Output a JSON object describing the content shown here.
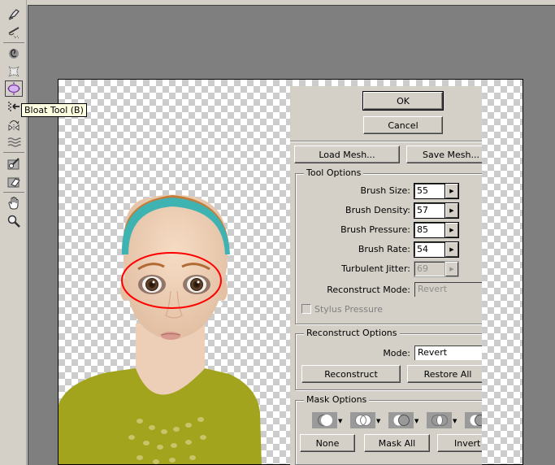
{
  "toolbar": {
    "tools": [
      {
        "name": "forward-warp-tool",
        "icon": "finger-push-icon"
      },
      {
        "name": "reconstruct-tool",
        "icon": "brush-reconstruct-icon"
      },
      {
        "name": "twirl-clockwise-tool",
        "icon": "twirl-icon"
      },
      {
        "name": "pucker-tool",
        "icon": "pucker-icon"
      },
      {
        "name": "bloat-tool",
        "icon": "bloat-icon",
        "active": true
      },
      {
        "name": "push-left-tool",
        "icon": "push-left-icon"
      },
      {
        "name": "mirror-tool",
        "icon": "mirror-icon"
      },
      {
        "name": "turbulence-tool",
        "icon": "turbulence-icon"
      },
      {
        "name": "freeze-mask-tool",
        "icon": "freeze-mask-icon"
      },
      {
        "name": "thaw-mask-tool",
        "icon": "thaw-mask-icon"
      },
      {
        "name": "hand-tool",
        "icon": "hand-icon"
      },
      {
        "name": "zoom-tool",
        "icon": "magnifier-icon"
      }
    ],
    "tooltip": "Bloat Tool (B)"
  },
  "dialog": {
    "ok_label": "OK",
    "cancel_label": "Cancel",
    "load_mesh_label": "Load Mesh...",
    "save_mesh_label": "Save Mesh...",
    "tool_options": {
      "title": "Tool Options",
      "brush_size_label": "Brush Size:",
      "brush_size": "55",
      "brush_density_label": "Brush Density:",
      "brush_density": "57",
      "brush_pressure_label": "Brush Pressure:",
      "brush_pressure": "85",
      "brush_rate_label": "Brush Rate:",
      "brush_rate": "54",
      "turbulent_jitter_label": "Turbulent Jitter:",
      "turbulent_jitter": "69",
      "reconstruct_mode_label": "Reconstruct Mode:",
      "reconstruct_mode": "Revert",
      "stylus_pressure_label": "Stylus Pressure",
      "stylus_pressure_checked": false
    },
    "reconstruct_options": {
      "title": "Reconstruct Options",
      "mode_label": "Mode:",
      "mode": "Revert",
      "reconstruct_label": "Reconstruct",
      "restore_all_label": "Restore All"
    },
    "mask_options": {
      "title": "Mask Options",
      "none_label": "None",
      "mask_all_label": "Mask All",
      "invert_label": "Invert All"
    }
  },
  "colors": {
    "annotation": "#ff0000",
    "panel_bg": "#d4d0c8",
    "workspace_bg": "#7f7f7f",
    "tooltip_bg": "#ffffe1"
  }
}
